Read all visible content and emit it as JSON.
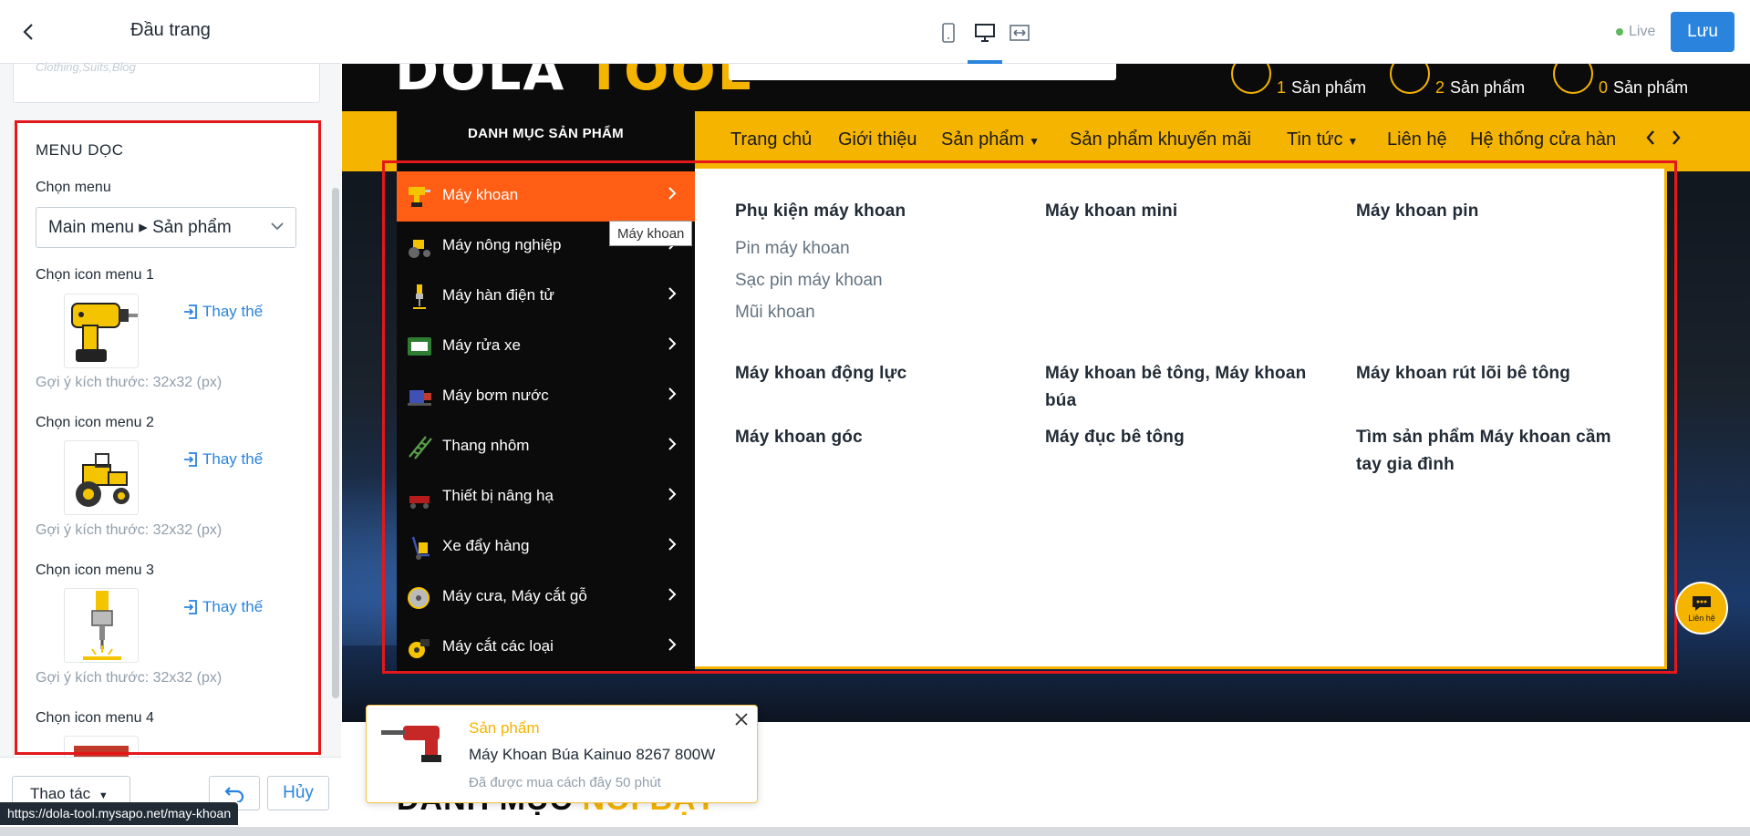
{
  "left_panel": {
    "title": "Đầu trang",
    "prev_value": "Clothing,Suits,Blog",
    "section_title": "MENU DỌC",
    "choose_menu_label": "Chọn menu",
    "menu_value": "Main menu ▸ Sản phẩm",
    "icon_items": [
      {
        "label": "Chọn icon menu 1",
        "replace": "Thay thế",
        "hint": "Gợi ý kích thước: 32x32 (px)"
      },
      {
        "label": "Chọn icon menu 2",
        "replace": "Thay thế",
        "hint": "Gợi ý kích thước: 32x32 (px)"
      },
      {
        "label": "Chọn icon menu 3",
        "replace": "Thay thế",
        "hint": "Gợi ý kích thước: 32x32 (px)"
      },
      {
        "label": "Chọn icon menu 4"
      }
    ],
    "footer": {
      "actions_label": "Thao tác",
      "cancel_label": "Hủy"
    }
  },
  "status_url": "https://dola-tool.mysapo.net/may-khoan",
  "toolbar": {
    "live_label": "Live",
    "save_label": "Lưu"
  },
  "site": {
    "logo_a": "DOLA ",
    "logo_b": "TOOL",
    "header_stats": [
      {
        "num": "1",
        "text": "Sản phẩm"
      },
      {
        "num": "2",
        "text": "Sản phẩm"
      },
      {
        "num": "0",
        "text": "Sản phẩm"
      }
    ],
    "category_heading": "DANH MỤC SẢN PHẨM",
    "nav": [
      "Trang chủ",
      "Giới thiệu",
      "Sản phẩm",
      "Sản phẩm khuyến mãi",
      "Tin tức",
      "Liên hệ",
      "Hệ thống cửa hàn"
    ],
    "categories": [
      "Máy khoan",
      "Máy nông nghiệp",
      "Máy hàn điện tử",
      "Máy rửa xe",
      "Máy bơm nước",
      "Thang nhôm",
      "Thiết bị nâng hạ",
      "Xe đẩy hàng",
      "Máy cưa, Máy cắt gỗ",
      "Máy cắt các loại"
    ],
    "tooltip": "Máy khoan",
    "mega_menu": {
      "col1_heading": "Phụ kiện máy khoan",
      "col1_links": [
        "Pin máy khoan",
        "Sạc pin máy khoan",
        "Mũi khoan"
      ],
      "col2_heading": "Máy khoan mini",
      "col3_heading": "Máy khoan pin",
      "row2": [
        "Máy khoan động lực",
        "Máy khoan bê tông, Máy khoan búa",
        "Máy khoan rút lõi bê tông"
      ],
      "row3": [
        "Máy khoan góc",
        "Máy đục bê tông",
        "Tìm sản phẩm Máy khoan cầm tay gia đình"
      ]
    },
    "chat_label": "Liên hệ",
    "section_title_a": "DANH MỤC ",
    "section_title_b": "NỔI BẬT",
    "popup": {
      "tag": "Sản phẩm",
      "name": "Máy Khoan Búa Kainuo 8267 800W",
      "time": "Đã được mua cách đây 50 phút"
    }
  },
  "colors": {
    "accent": "#2a84de",
    "brand_yellow": "#f5b400",
    "active_orange": "#ff5e14",
    "highlight_red": "#e4171b"
  }
}
